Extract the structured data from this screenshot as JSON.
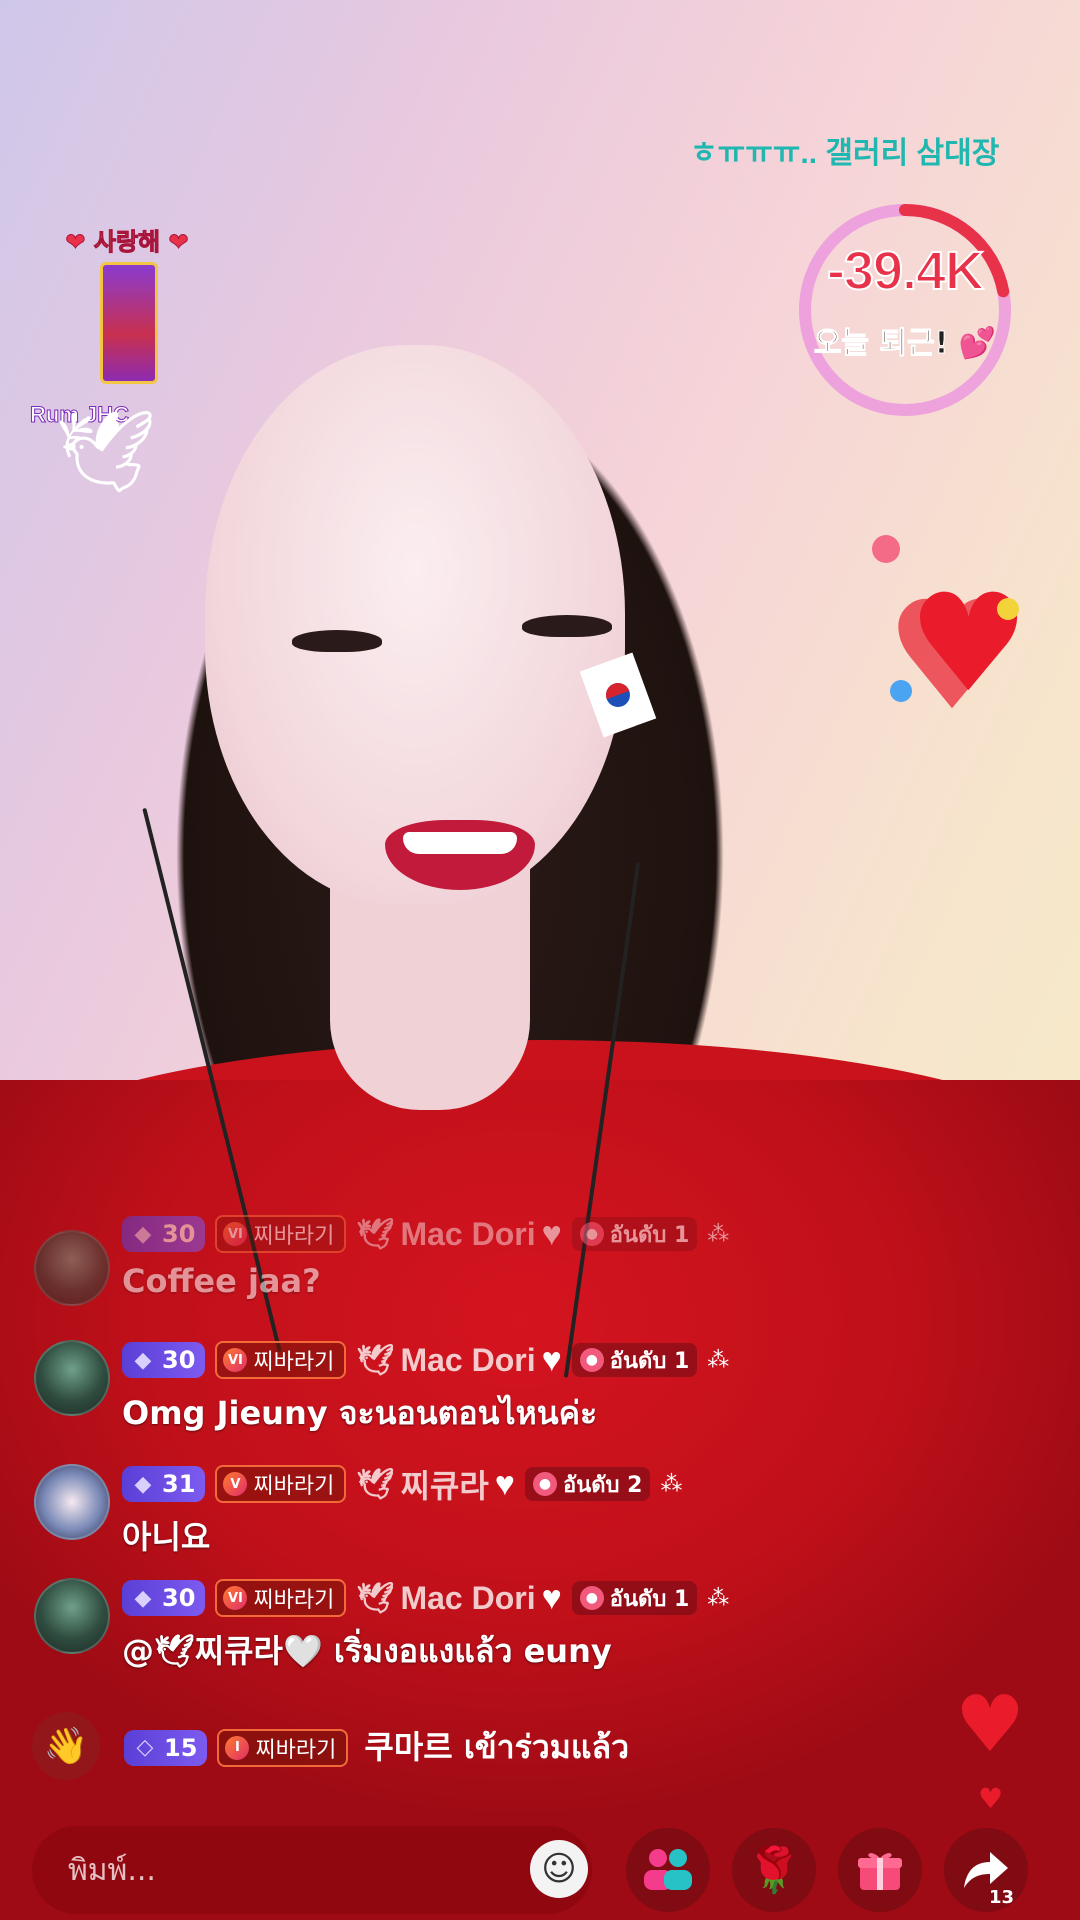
{
  "ticker": {
    "text": "ㅎㅠㅠㅠ..   갤러리 삼대장"
  },
  "goal": {
    "amount": "-39.4K",
    "label": "오늘 퇴근!",
    "progress": 0.22,
    "ring_color": "#e8324a",
    "track_color": "#e98adf"
  },
  "sticker": {
    "title": "사랑해",
    "name": "Rum  JHC"
  },
  "chat": [
    {
      "level": "30",
      "fan": "찌바라기",
      "fan_badge": "VI",
      "user": "Mac Dori",
      "rank": "อันดับ 1",
      "message": "Coffee jaa?"
    },
    {
      "level": "30",
      "fan": "찌바라기",
      "fan_badge": "VI",
      "user": "Mac Dori",
      "rank": "อันดับ 1",
      "message": "Omg Jieuny จะนอนตอนไหนค่ะ"
    },
    {
      "level": "31",
      "fan": "찌바라기",
      "fan_badge": "V",
      "user": "찌큐라",
      "rank": "อันดับ 2",
      "message": "아니요"
    },
    {
      "level": "30",
      "fan": "찌바라기",
      "fan_badge": "VI",
      "user": "Mac Dori",
      "rank": "อันดับ 1",
      "message": "@🕊찌큐라🤍 เริ่มงอแงแล้ว euny"
    }
  ],
  "join": {
    "level": "15",
    "fan": "찌바라기",
    "fan_badge": "I",
    "text": "쿠마르 เข้าร่วมแล้ว"
  },
  "bottom": {
    "placeholder": "พิมพ์...",
    "share_count": "13"
  },
  "colors": {
    "accent_red": "#ea1c2c",
    "level_purple": "#6a4ce6"
  }
}
